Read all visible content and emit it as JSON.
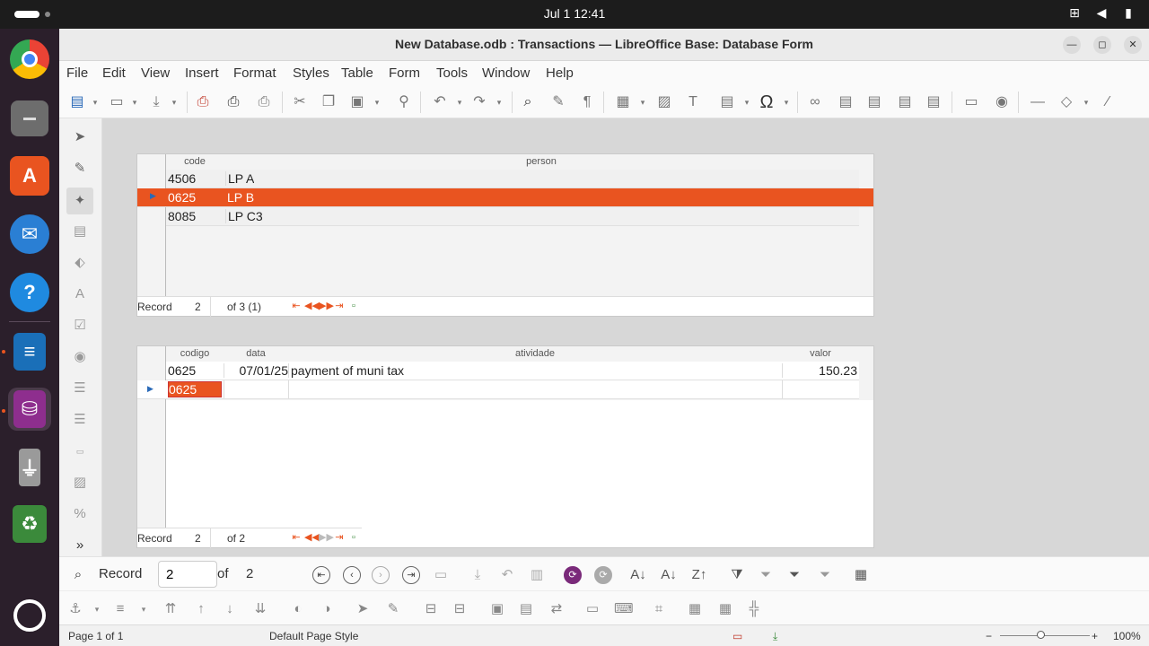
{
  "system": {
    "clock": "Jul 1  12:41",
    "tray_icons": [
      "network-icon",
      "volume-icon",
      "power-icon"
    ]
  },
  "dock": {
    "apps": [
      "chrome",
      "files",
      "app-center",
      "thunderbird",
      "help",
      "writer",
      "base",
      "usb-drive",
      "trash",
      "show-apps"
    ]
  },
  "window": {
    "title": "New Database.odb : Transactions — LibreOffice Base: Database Form",
    "controls": [
      "minimize",
      "maximize",
      "close"
    ]
  },
  "menu": [
    "File",
    "Edit",
    "View",
    "Insert",
    "Format",
    "Styles",
    "Table",
    "Form",
    "Tools",
    "Window",
    "Help"
  ],
  "top_grid": {
    "headers": [
      "code",
      "person"
    ],
    "rows": [
      {
        "code": "4506",
        "person": "LP A"
      },
      {
        "code": "0625",
        "person": "LP B"
      },
      {
        "code": "8085",
        "person": "LP C3"
      }
    ],
    "selected_index": 1,
    "nav": {
      "record_label": "Record",
      "record": "2",
      "of_text": "of 3 (1)"
    }
  },
  "bottom_grid": {
    "headers": [
      "codigo",
      "data",
      "atividade",
      "valor"
    ],
    "rows": [
      {
        "codigo": "0625",
        "data": "07/01/25",
        "atividade": "payment of muni tax",
        "valor": "150.23"
      },
      {
        "codigo": "0625",
        "data": "",
        "atividade": "",
        "valor": ""
      }
    ],
    "nav": {
      "record_label": "Record",
      "record": "2",
      "of_text": "of 2"
    }
  },
  "form_nav": {
    "record_label": "Record",
    "record_value": "2",
    "of_label": "of",
    "total": "2"
  },
  "status": {
    "page": "Page 1 of 1",
    "style": "Default Page Style",
    "zoom": "100%"
  },
  "colors": {
    "accent": "#e95420",
    "dock_bg": "#2b1f2b",
    "topbar_bg": "#1c1c1c"
  }
}
